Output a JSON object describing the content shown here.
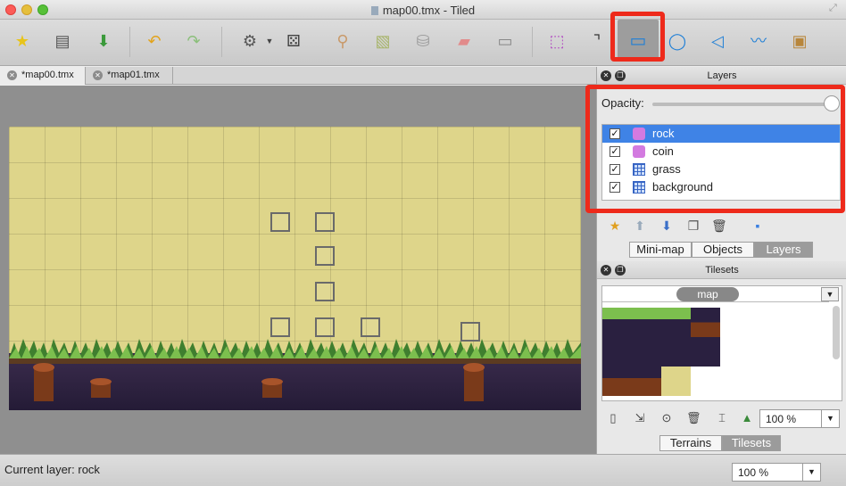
{
  "window": {
    "title": "map00.tmx - Tiled"
  },
  "toolbar": {
    "items": [
      {
        "name": "new-map",
        "glyph": "★"
      },
      {
        "name": "open",
        "glyph": "▤"
      },
      {
        "name": "save",
        "glyph": "⬇"
      },
      {
        "name": "undo",
        "glyph": "↶"
      },
      {
        "name": "redo",
        "glyph": "↷"
      },
      {
        "name": "random-mode",
        "glyph": "⚙"
      },
      {
        "name": "random-dice",
        "glyph": "⚄"
      },
      {
        "name": "stamp-brush",
        "glyph": "⚲"
      },
      {
        "name": "terrain-brush",
        "glyph": "▧"
      },
      {
        "name": "bucket-fill",
        "glyph": "⛁"
      },
      {
        "name": "eraser",
        "glyph": "▰"
      },
      {
        "name": "rect-select",
        "glyph": "▭"
      },
      {
        "name": "select-objects",
        "glyph": "⬚"
      },
      {
        "name": "edit-polygons",
        "glyph": "⌝"
      },
      {
        "name": "insert-rectangle",
        "glyph": "▭"
      },
      {
        "name": "insert-ellipse",
        "glyph": "◯"
      },
      {
        "name": "insert-polygon",
        "glyph": "◁"
      },
      {
        "name": "insert-polyline",
        "glyph": "〰"
      },
      {
        "name": "insert-tile",
        "glyph": "▣"
      }
    ]
  },
  "tabs": [
    {
      "label": "*map00.tmx",
      "active": true
    },
    {
      "label": "*map01.tmx",
      "active": false
    }
  ],
  "status": {
    "current_layer": "Current layer: rock",
    "zoom": "100 %"
  },
  "layers_panel": {
    "title": "Layers",
    "opacity_label": "Opacity:",
    "opacity_value": 1.0,
    "layers": [
      {
        "name": "rock",
        "type": "object",
        "visible": true,
        "selected": true
      },
      {
        "name": "coin",
        "type": "object",
        "visible": true,
        "selected": false
      },
      {
        "name": "grass",
        "type": "tile",
        "visible": true,
        "selected": false
      },
      {
        "name": "background",
        "type": "tile",
        "visible": true,
        "selected": false
      }
    ],
    "tabs": [
      "Mini-map",
      "Objects",
      "Layers"
    ],
    "active_tab": "Layers"
  },
  "tilesets_panel": {
    "title": "Tilesets",
    "tileset_name": "map",
    "zoom": "100 %",
    "tabs": [
      "Terrains",
      "Tilesets"
    ],
    "active_tab": "Tilesets"
  },
  "colors": {
    "highlight": "#ee2a1b",
    "selection": "#3f83e6",
    "map_background": "#ded58a",
    "canvas_background": "#8f8f8f"
  }
}
